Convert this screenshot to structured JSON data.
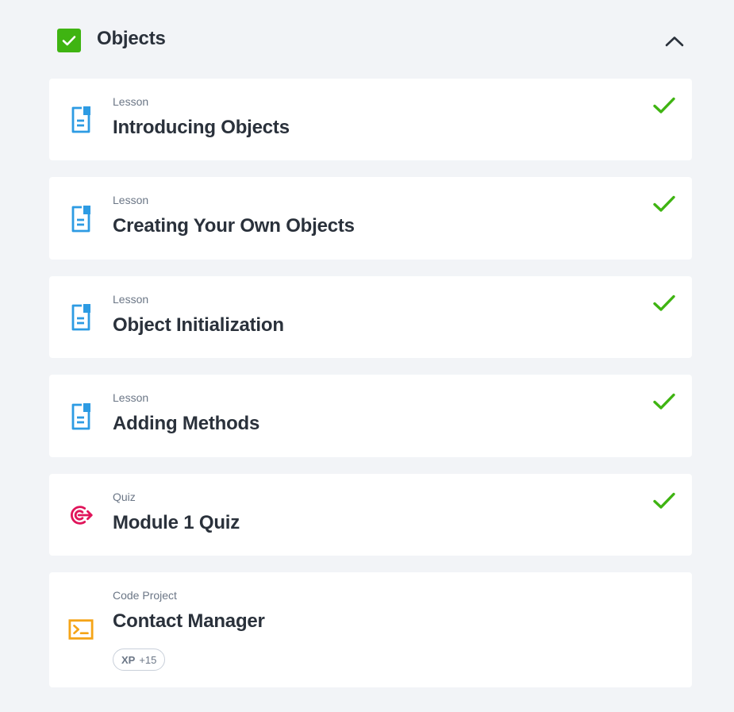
{
  "module": {
    "title": "Objects",
    "completed": true,
    "expanded": true,
    "check_color": "#3fb412"
  },
  "items": [
    {
      "type": "Lesson",
      "title": "Introducing Objects",
      "icon": "lesson-document-icon",
      "completed": true
    },
    {
      "type": "Lesson",
      "title": "Creating Your Own Objects",
      "icon": "lesson-document-icon",
      "completed": true
    },
    {
      "type": "Lesson",
      "title": "Object Initialization",
      "icon": "lesson-document-icon",
      "completed": true
    },
    {
      "type": "Lesson",
      "title": "Adding Methods",
      "icon": "lesson-document-icon",
      "completed": true
    },
    {
      "type": "Quiz",
      "title": "Module 1 Quiz",
      "icon": "quiz-target-icon",
      "completed": true
    },
    {
      "type": "Code Project",
      "title": "Contact Manager",
      "icon": "terminal-icon",
      "completed": false,
      "xp": {
        "label": "XP",
        "value": "+15"
      }
    }
  ],
  "colors": {
    "lesson_icon": "#2d9be3",
    "quiz_icon": "#e0145a",
    "project_icon": "#f5a417",
    "completed_check": "#3fb412",
    "title_text": "#2a313b",
    "meta_text": "#6b7686",
    "background": "#f2f4f7"
  }
}
